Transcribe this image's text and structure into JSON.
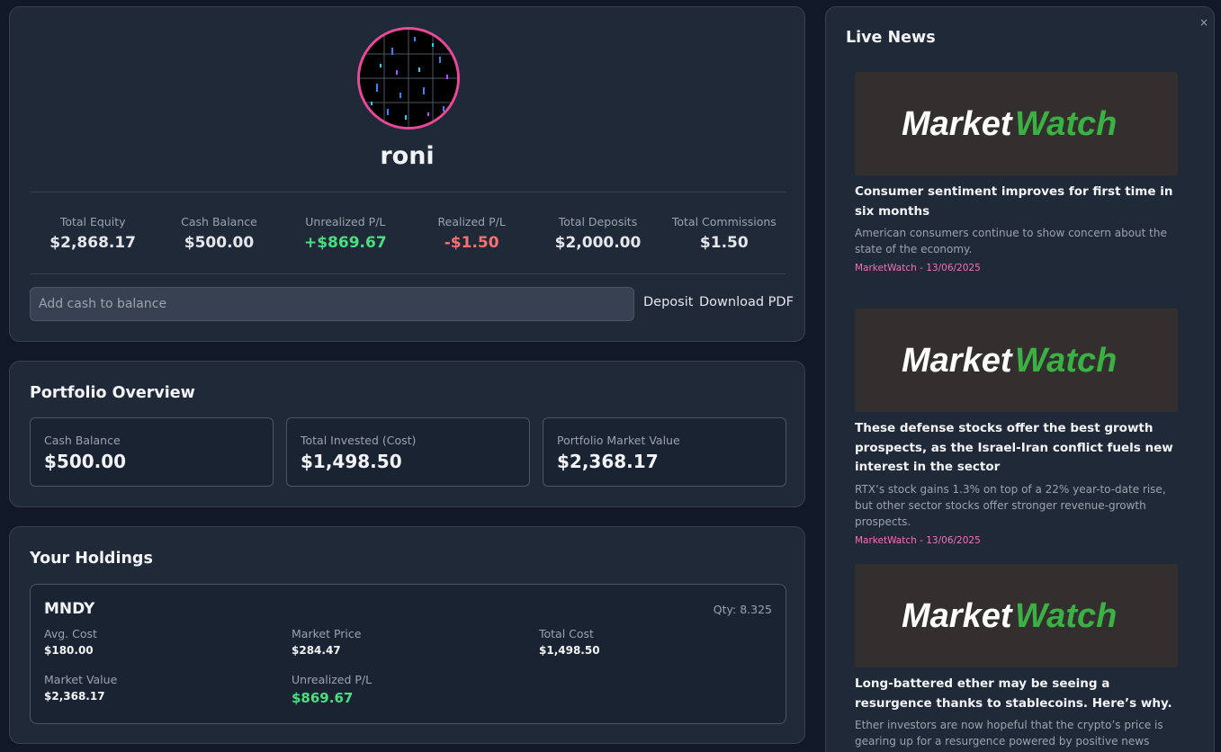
{
  "profile": {
    "username": "roni",
    "stats": [
      {
        "label": "Total Equity",
        "value": "$2,868.17",
        "tone": "neutral"
      },
      {
        "label": "Cash Balance",
        "value": "$500.00",
        "tone": "neutral"
      },
      {
        "label": "Unrealized P/L",
        "value": "+$869.67",
        "tone": "pos"
      },
      {
        "label": "Realized P/L",
        "value": "-$1.50",
        "tone": "neg"
      },
      {
        "label": "Total Deposits",
        "value": "$2,000.00",
        "tone": "neutral"
      },
      {
        "label": "Total Commissions",
        "value": "$1.50",
        "tone": "neutral"
      }
    ],
    "cash_input_placeholder": "Add cash to balance",
    "deposit_label": "Deposit",
    "download_pdf_label": "Download PDF",
    "avatar_border_color": "#ec4899"
  },
  "overview": {
    "title": "Portfolio Overview",
    "boxes": [
      {
        "label": "Cash Balance",
        "value": "$500.00"
      },
      {
        "label": "Total Invested (Cost)",
        "value": "$1,498.50"
      },
      {
        "label": "Portfolio Market Value",
        "value": "$2,368.17"
      }
    ]
  },
  "holdings": {
    "title": "Your Holdings",
    "items": [
      {
        "symbol": "MNDY",
        "qty": "Qty: 8.325",
        "avg_cost_label": "Avg. Cost",
        "avg_cost": "$180.00",
        "market_price_label": "Market Price",
        "market_price": "$284.47",
        "total_cost_label": "Total Cost",
        "total_cost": "$1,498.50",
        "market_value_label": "Market Value",
        "market_value": "$2,368.17",
        "unrealized_label": "Unrealized P/L",
        "unrealized": "$869.67"
      }
    ]
  },
  "news": {
    "title": "Live News",
    "close_icon": "×",
    "items": [
      {
        "logo_text_a": "Market",
        "logo_text_b": "Watch",
        "headline": "Consumer sentiment improves for first time in six months",
        "description": "American consumers continue to show concern about the state of the economy.",
        "meta": "MarketWatch - 13/06/2025"
      },
      {
        "logo_text_a": "Market",
        "logo_text_b": "Watch",
        "headline": "These defense stocks offer the best growth prospects, as the Israel-Iran conflict fuels new interest in the sector",
        "description": "RTX’s stock gains 1.3% on top of a 22% year-to-date rise, but other sector stocks offer stronger revenue-growth prospects.",
        "meta": "MarketWatch - 13/06/2025"
      },
      {
        "logo_text_a": "Market",
        "logo_text_b": "Watch",
        "headline": "Long-battered ether may be seeing a resurgence thanks to stablecoins. Here’s why.",
        "description": "Ether investors are now hopeful that the crypto’s price is gearing up for a resurgence powered by positive news around",
        "meta": ""
      }
    ]
  },
  "colors": {
    "positive": "#4ade80",
    "negative": "#f87171",
    "accent_pink": "#ec4899",
    "marketwatch_green": "#3bb143"
  }
}
